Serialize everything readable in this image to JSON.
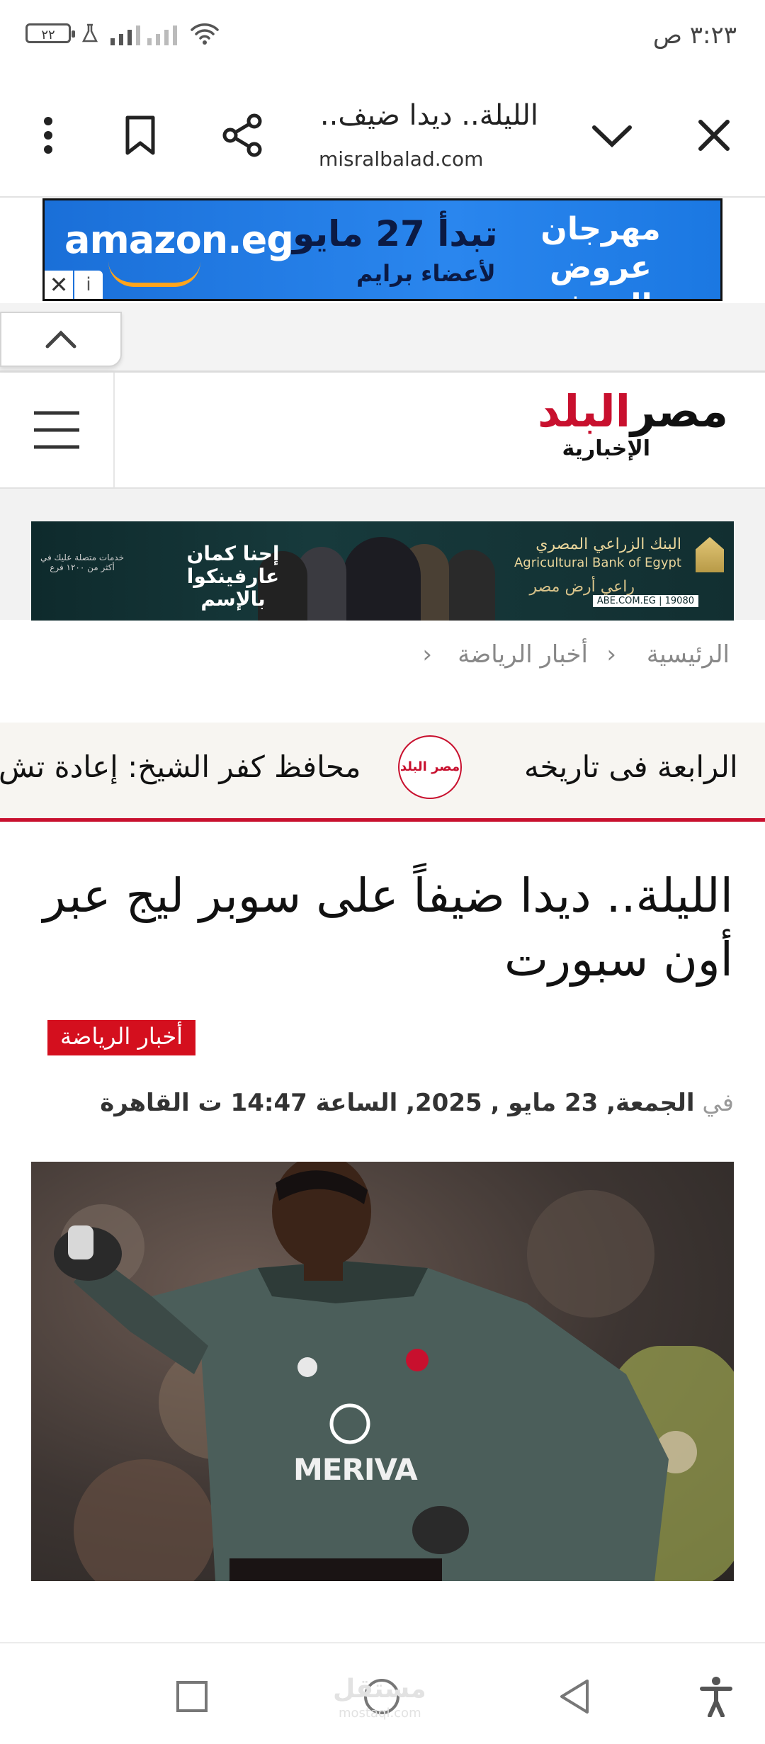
{
  "status_bar": {
    "time": "٣:٢٣ ص",
    "battery": "٢٢"
  },
  "browser": {
    "page_title": "الليلة.. ديدا ضيف..",
    "url": "misralbalad.com"
  },
  "ad_banner": {
    "brand": "amazon.eg",
    "headline": "تبدأ 27 مايو",
    "subline": "لأعضاء برايم",
    "festival": "مهرجان عروض الصيف",
    "close_glyph": "✕",
    "info_glyph": "i"
  },
  "site": {
    "logo_main": "مصر",
    "logo_main_b": "البلد",
    "logo_sub": "الإخبارية"
  },
  "bank_ad": {
    "name_ar": "البنك الزراعي المصري",
    "name_en": "Agricultural Bank of Egypt",
    "slogan": "راعي أرض مصر",
    "url": "ABE.COM.EG | 19080",
    "campaign": "إحنا كمان عارفينكوا بالإسم",
    "tagline": "خدمات متصلة عليك في أكثر من ١٢٠٠ فرع"
  },
  "breadcrumb": {
    "home": "الرئيسية",
    "sep1": "‹",
    "section": "أخبار الرياضة",
    "sep2": "‹"
  },
  "ticker": {
    "left_text": "محافظ كفر الشيخ: إعادة تش",
    "right_text": "الرابعة فى تاريخه",
    "logo_text": "مصر البلد"
  },
  "article": {
    "title": "الليلة.. ديدا ضيفاً على سوبر ليج عبر أون سبورت",
    "category": "أخبار الرياضة",
    "date_prefix": "في",
    "date_text": "الجمعة, 23 مايو , 2025, الساعة 14:47 ت القاهرة"
  },
  "photo": {
    "sponsor": "MERIVA"
  },
  "nav_bar": {
    "watermark": "مستقل",
    "watermark_sub": "mostaql.com"
  },
  "colors": {
    "brand_red": "#c8102e",
    "tag_red": "#d40f1e",
    "ad_blue": "#1a6fd8"
  }
}
